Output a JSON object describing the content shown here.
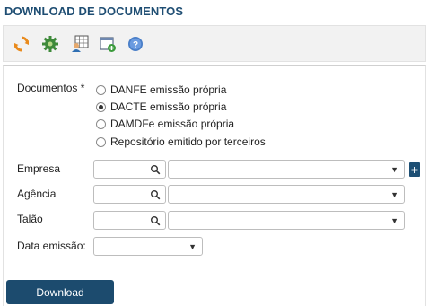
{
  "page": {
    "title": "DOWNLOAD DE DOCUMENTOS"
  },
  "toolbar": {
    "icons": [
      "refresh-icon",
      "gear-icon",
      "user-grid-icon",
      "add-window-icon",
      "help-icon"
    ]
  },
  "form": {
    "documentos": {
      "label": "Documentos *",
      "options": [
        {
          "label": "DANFE emissão própria",
          "checked": false
        },
        {
          "label": "DACTE emissão própria",
          "checked": true
        },
        {
          "label": "DAMDFe emissão própria",
          "checked": false
        },
        {
          "label": "Repositório emitido por terceiros",
          "checked": false
        }
      ]
    },
    "empresa": {
      "label": "Empresa",
      "code": "",
      "value": ""
    },
    "agencia": {
      "label": "Agência",
      "code": "",
      "value": ""
    },
    "talao": {
      "label": "Talão",
      "code": "",
      "value": ""
    },
    "data_emissao": {
      "label": "Data emissão:",
      "value": ""
    }
  },
  "actions": {
    "download_label": "Download"
  },
  "colors": {
    "title": "#1f4e73",
    "button": "#1c4b6e"
  }
}
